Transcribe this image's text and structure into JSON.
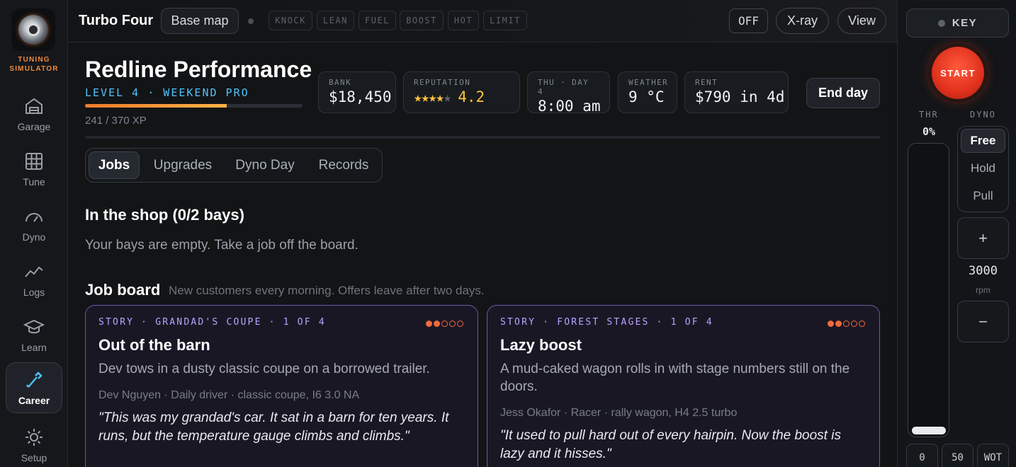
{
  "brand": {
    "name_line1": "TUNING",
    "name_line2": "SIMULATOR"
  },
  "nav": [
    {
      "label": "Garage",
      "icon": "garage-icon"
    },
    {
      "label": "Tune",
      "icon": "grid-icon"
    },
    {
      "label": "Dyno",
      "icon": "gauge-icon"
    },
    {
      "label": "Logs",
      "icon": "chart-line-icon"
    },
    {
      "label": "Learn",
      "icon": "graduation-cap-icon"
    },
    {
      "label": "Career",
      "icon": "wrench-icon",
      "active": true
    },
    {
      "label": "Setup",
      "icon": "gear-icon"
    }
  ],
  "topbar": {
    "car_name": "Turbo Four",
    "base_map": "Base map",
    "flags": [
      "KNOCK",
      "LEAN",
      "FUEL",
      "BOOST",
      "HOT",
      "LIMIT"
    ],
    "off": "OFF",
    "xray": "X-ray",
    "view": "View"
  },
  "profile": {
    "title": "Redline Performance",
    "level": "LEVEL 4 · WEEKEND PRO",
    "xp": "241 / 370 XP",
    "xp_fraction": 0.651
  },
  "stats": {
    "bank": {
      "label": "BANK",
      "value": "$18,450"
    },
    "reputation": {
      "label": "REPUTATION",
      "stars": 4,
      "max_stars": 5,
      "value": "4.2"
    },
    "day": {
      "label": "THU · DAY 4",
      "value": "8:00 am"
    },
    "weather": {
      "label": "WEATHER",
      "value": "9 °C"
    },
    "rent": {
      "label": "RENT",
      "value": "$790 in 4d"
    }
  },
  "end_day": "End day",
  "tabs": [
    "Jobs",
    "Upgrades",
    "Dyno Day",
    "Records"
  ],
  "active_tab": "Jobs",
  "shop": {
    "heading": "In the shop (0/2 bays)",
    "empty_text": "Your bays are empty. Take a job off the board."
  },
  "board": {
    "heading": "Job board",
    "subtitle": "New customers every morning. Offers leave after two days.",
    "cards": [
      {
        "tag": "STORY · GRANDAD'S COUPE · 1 OF 4",
        "difficulty": 2,
        "difficulty_max": 5,
        "title": "Out of the barn",
        "description": "Dev tows in a dusty classic coupe on a borrowed trailer.",
        "customer": "Dev Nguyen · Daily driver · classic coupe, I6 3.0 NA",
        "quote": "\"This was my grandad's car. It sat in a barn for ten years. It runs, but the temperature gauge climbs and climbs.\""
      },
      {
        "tag": "STORY · FOREST STAGES · 1 OF 4",
        "difficulty": 2,
        "difficulty_max": 5,
        "title": "Lazy boost",
        "description": "A mud-caked wagon rolls in with stage numbers still on the doors.",
        "customer": "Jess Okafor · Racer · rally wagon, H4 2.5 turbo",
        "quote": "\"It used to pull hard out of every hairpin. Now the boost is lazy and it hisses.\""
      }
    ]
  },
  "controls": {
    "key": "KEY",
    "start": "START",
    "thr_label": "THR",
    "thr_value": "0%",
    "throttle_fraction": 0,
    "dyno_label": "DYNO",
    "modes": [
      "Free",
      "Hold",
      "Pull"
    ],
    "active_mode": "Free",
    "plus": "+",
    "minus": "−",
    "rpm": "3000",
    "rpm_unit": "rpm",
    "presets": [
      "0",
      "50",
      "WOT"
    ]
  },
  "colors": {
    "accent_blue": "#4fc3ff",
    "accent_orange": "#f07a2a",
    "star": "#ffc23d",
    "card_border": "#6b5aa8",
    "start_red": "#e0311d"
  }
}
